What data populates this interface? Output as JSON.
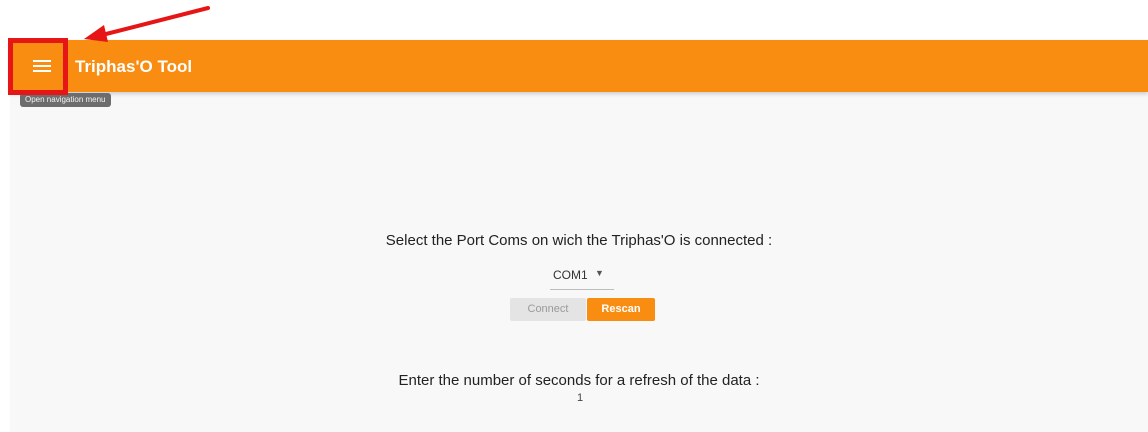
{
  "toolbar": {
    "title": "Triphas'O Tool",
    "menu_icon": "menu-icon",
    "tooltip": "Open navigation menu",
    "color": "#f98d12"
  },
  "port_section": {
    "prompt": "Select the Port Coms on wich the Triphas'O is connected :",
    "selected_port": "COM1",
    "dropdown_icon": "caret-down-icon",
    "connect_label": "Connect",
    "rescan_label": "Rescan"
  },
  "refresh_section": {
    "prompt": "Enter the number of seconds for a refresh of the data :",
    "value": "1"
  },
  "annotation": {
    "color": "#e61616"
  }
}
